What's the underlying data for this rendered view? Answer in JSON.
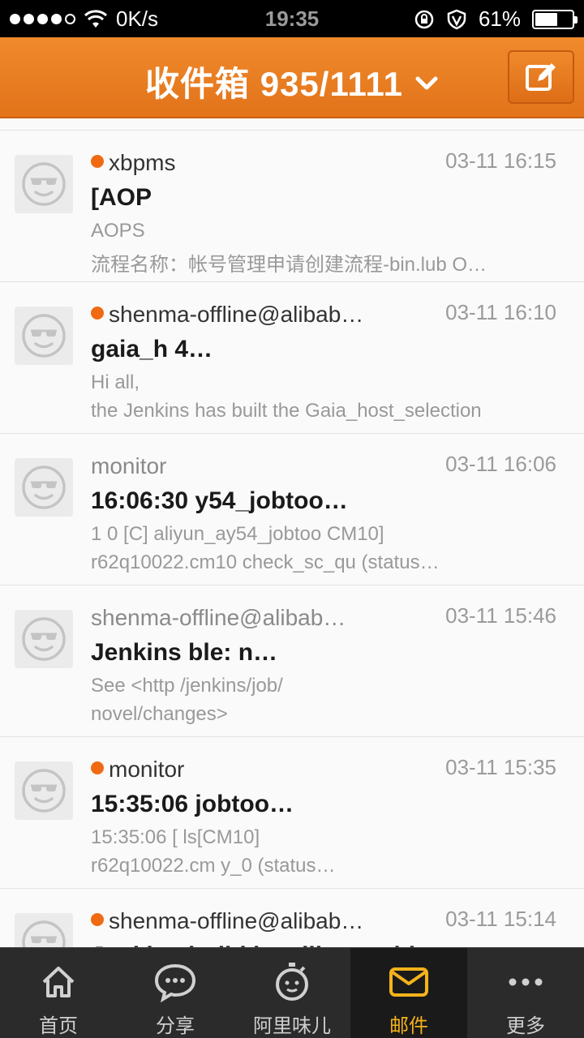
{
  "status_bar": {
    "network": "0K/s",
    "time": "19:35",
    "battery": "61%",
    "battery_level": 0.61
  },
  "header": {
    "title": "收件箱 935/1111",
    "compose_icon": "compose-icon"
  },
  "mails": [
    {
      "unread": true,
      "sender": "xbpms",
      "time": "03-11 16:15",
      "subject": "[AOP",
      "preview1": "AOPS",
      "preview2": "流程名称：帐号管理申请创建流程-bin.lub O…"
    },
    {
      "unread": true,
      "sender": "shenma-offline@alibab…",
      "time": "03-11 16:10",
      "subject": "gaia_h                                   4…",
      "preview1": "Hi all,",
      "preview2": "the Jenkins has built the Gaia_host_selection"
    },
    {
      "unread": false,
      "sender": "monitor",
      "time": "03-11 16:06",
      "subject": "16:06:30                  y54_jobtoo…",
      "preview1": "1      0 [C] aliyun_ay54_jobtoo   CM10]",
      "preview2": "r62q10022.cm10 check_sc_qu           (status…"
    },
    {
      "unread": false,
      "sender": "shenma-offline@alibab…",
      "time": "03-11 15:46",
      "subject": "Jenkins                           ble: n…",
      "preview1": "See <http                          /jenkins/job/",
      "preview2": "novel/changes>"
    },
    {
      "unread": true,
      "sender": "monitor",
      "time": "03-11 15:35",
      "subject": "15:35:06                     jobtoo…",
      "preview1": "15:35:06 [                        ls[CM10]",
      "preview2": "r62q10022.cm                     y_0 (status…"
    },
    {
      "unread": true,
      "sender": "shenma-offline@alibab…",
      "time": "03-11 15:14",
      "subject": "Jenkins build is still unstable",
      "preview1": "",
      "preview2": ""
    }
  ],
  "tabs": [
    {
      "label": "首页",
      "icon": "home-icon",
      "active": false
    },
    {
      "label": "分享",
      "icon": "chat-bubble-icon",
      "active": false
    },
    {
      "label": "阿里味儿",
      "icon": "stopwatch-face-icon",
      "active": false
    },
    {
      "label": "邮件",
      "icon": "mail-icon",
      "active": true
    },
    {
      "label": "更多",
      "icon": "more-dots-icon",
      "active": false
    }
  ],
  "colors": {
    "header_orange": "#e8781f",
    "unread_dot": "#f06a13",
    "tab_active": "#f5b21b",
    "tab_bar": "#2b2b2b"
  }
}
